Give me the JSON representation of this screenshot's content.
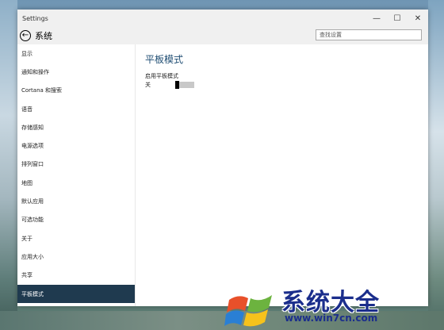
{
  "window": {
    "title": "Settings",
    "controls": {
      "minimize": "—",
      "maximize": "☐",
      "close": "✕"
    }
  },
  "header": {
    "back_glyph": "←",
    "page_name": "系统",
    "search_placeholder": "查找设置"
  },
  "sidebar": {
    "items": [
      {
        "label": "显示"
      },
      {
        "label": "通知和操作"
      },
      {
        "label": "Cortana 和搜索"
      },
      {
        "label": "语音"
      },
      {
        "label": "存储感知"
      },
      {
        "label": "电源选项"
      },
      {
        "label": "排列窗口"
      },
      {
        "label": "地图"
      },
      {
        "label": "默认应用"
      },
      {
        "label": "可选功能"
      },
      {
        "label": "关于"
      },
      {
        "label": "应用大小"
      },
      {
        "label": "共享"
      },
      {
        "label": "平板模式"
      }
    ],
    "active_index": 13
  },
  "main": {
    "heading": "平板模式",
    "setting_label": "启用平板模式",
    "setting_value": "关"
  },
  "watermark": {
    "brand_cn": "系统大全",
    "url": "www.win7cn.com"
  },
  "colors": {
    "accent": "#1f3a4f",
    "heading": "#1f4d73",
    "brand": "#1b2e8c"
  }
}
